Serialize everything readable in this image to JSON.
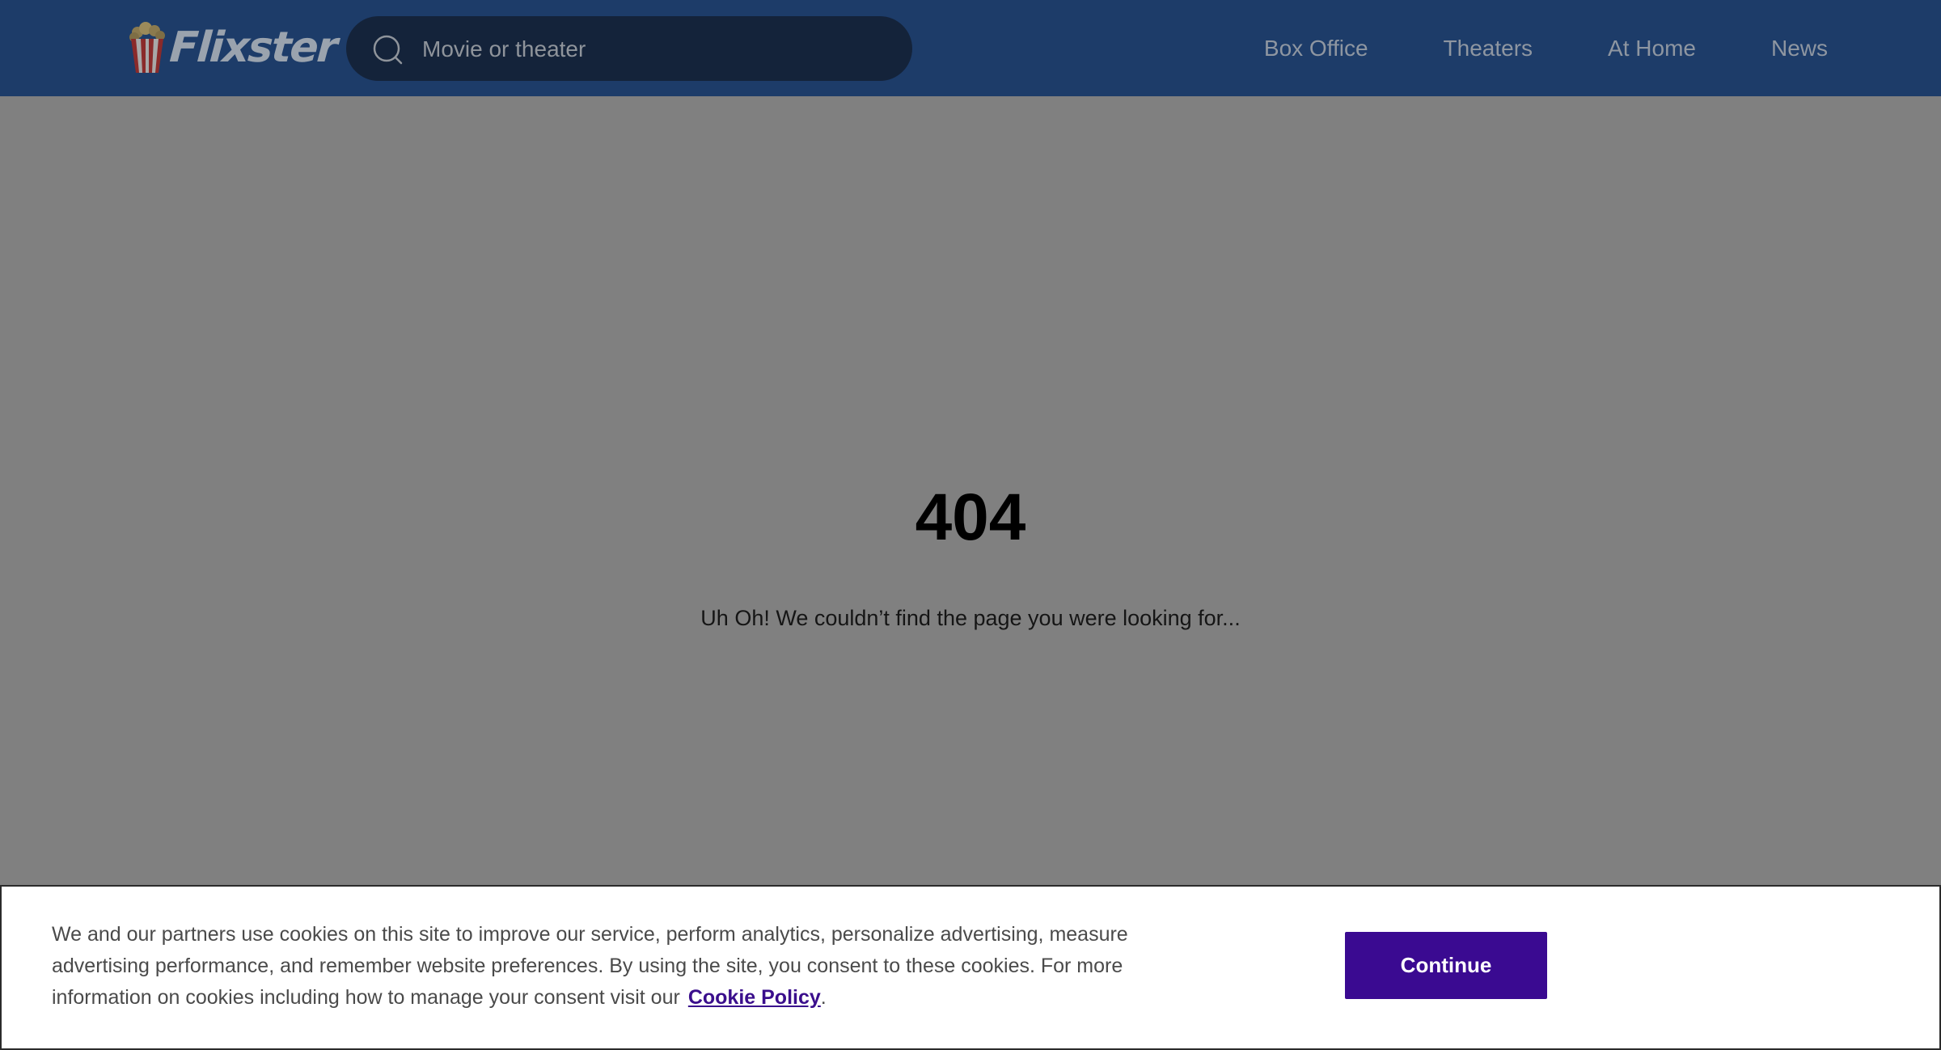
{
  "header": {
    "logo_text": "Flixster",
    "search": {
      "placeholder": "Movie or theater",
      "icon": "search-icon"
    },
    "nav": [
      {
        "label": "Box Office"
      },
      {
        "label": "Theaters"
      },
      {
        "label": "At Home"
      },
      {
        "label": "News"
      }
    ],
    "background_color": "#1d3c69"
  },
  "main": {
    "error_code": "404",
    "message": "Uh Oh! We couldn’t find the page you were looking for..."
  },
  "cookie_banner": {
    "text": "We and our partners use cookies on this site to improve our service, perform analytics, personalize advertising, measure advertising performance, and remember website preferences. By using the site, you consent to these cookies. For more information on cookies including how to manage your consent visit our",
    "link_label": "Cookie Policy",
    "trailing": ".",
    "button_label": "Continue",
    "button_color": "#3a0a91"
  }
}
